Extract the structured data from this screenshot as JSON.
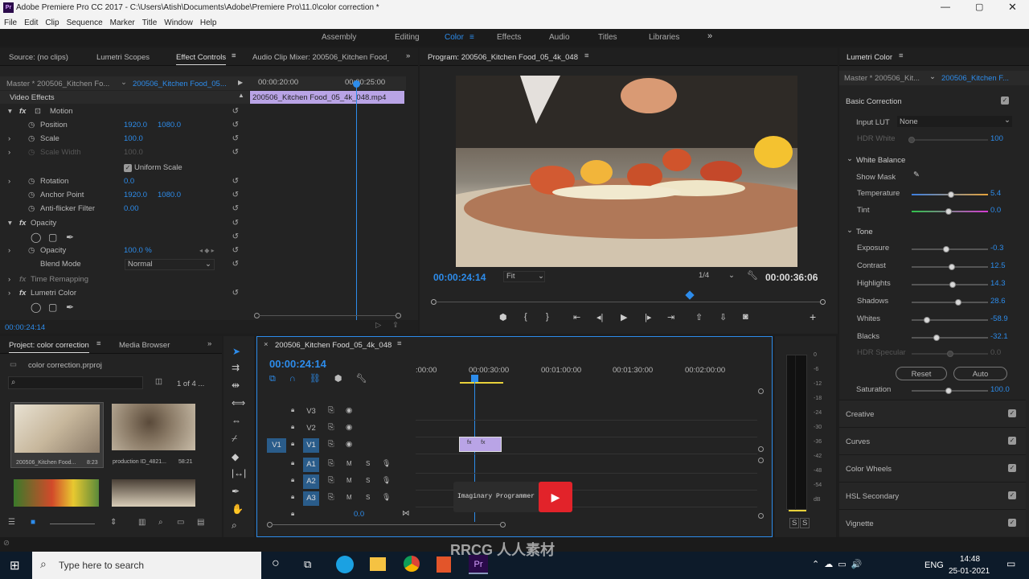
{
  "window": {
    "title": "Adobe Premiere Pro CC 2017 - C:\\Users\\Atish\\Documents\\Adobe\\Premiere Pro\\11.0\\color correction *",
    "app_icon": "Pr"
  },
  "menu": [
    "File",
    "Edit",
    "Clip",
    "Sequence",
    "Marker",
    "Title",
    "Window",
    "Help"
  ],
  "workspaces": [
    "Assembly",
    "Editing",
    "Color",
    "Effects",
    "Audio",
    "Titles",
    "Libraries"
  ],
  "active_workspace": "Color",
  "source_tabs": [
    "Source: (no clips)",
    "Lumetri Scopes",
    "Effect Controls",
    "Audio Clip Mixer: 200506_Kitchen Food_("
  ],
  "effect_controls": {
    "master": "Master * 200506_Kitchen Fo...",
    "clip": "200506_Kitchen Food_05...",
    "ruler": [
      "00:00:20:00",
      "00:00:25:00"
    ],
    "clip_bar": "200506_Kitchen Food_05_4k_048.mp4",
    "video_effects": "Video Effects",
    "motion": "Motion",
    "position": "Position",
    "pos_x": "1920.0",
    "pos_y": "1080.0",
    "scale": "Scale",
    "scale_val": "100.0",
    "scale_width": "Scale Width",
    "scale_width_val": "100.0",
    "uniform_scale": "Uniform Scale",
    "rotation": "Rotation",
    "rotation_val": "0.0",
    "anchor": "Anchor Point",
    "anchor_x": "1920.0",
    "anchor_y": "1080.0",
    "antiflicker": "Anti-flicker Filter",
    "antiflicker_val": "0.00",
    "opacity": "Opacity",
    "opacity_val": "100.0 %",
    "blend": "Blend Mode",
    "blend_val": "Normal",
    "time_remap": "Time Remapping",
    "lumetri": "Lumetri Color",
    "timecode": "00:00:24:14"
  },
  "program": {
    "title": "Program: 200506_Kitchen Food_05_4k_048",
    "timecode": "00:00:24:14",
    "fit": "Fit",
    "res": "1/4",
    "duration": "00:00:36:06",
    "playhead_fraction": 0.66
  },
  "project": {
    "tabs": [
      "Project: color correction",
      "Media Browser"
    ],
    "file": "color correction.prproj",
    "count": "1 of 4 ...",
    "items": [
      {
        "name": "200506_Kitchen Food...",
        "dur": "8:23"
      },
      {
        "name": "production ID_4821...",
        "dur": "58:21"
      }
    ]
  },
  "timeline": {
    "title": "200506_Kitchen Food_05_4k_048",
    "timecode": "00:00:24:14",
    "ruler": [
      ":00:00",
      "00:00:30:00",
      "00:01:00:00",
      "00:01:30:00",
      "00:02:00:00"
    ],
    "tracks": [
      "V3",
      "V2",
      "V1",
      "A1",
      "A2",
      "A3"
    ],
    "source_patch_v": "V1",
    "source_patch_a": "A1",
    "master_val": "0.0",
    "overlay_label": "Imaginary Programmer"
  },
  "meter": {
    "ticks": [
      "0",
      "-6",
      "-12",
      "-18",
      "-24",
      "-30",
      "-36",
      "-42",
      "-48",
      "-54",
      "dB"
    ],
    "solo": [
      "S",
      "S"
    ]
  },
  "lumetri": {
    "title": "Lumetri Color",
    "master": "Master * 200506_Kit...",
    "clip": "200506_Kitchen F...",
    "basic": "Basic Correction",
    "input_lut": "Input LUT",
    "lut_val": "None",
    "hdr_white": "HDR White",
    "hdr_white_val": "100",
    "wb": "White Balance",
    "show_mask": "Show Mask",
    "sliders": [
      {
        "label": "Temperature",
        "value": "5.4",
        "pos": 0.52
      },
      {
        "label": "Tint",
        "value": "0.0",
        "pos": 0.48
      },
      {
        "label": "Exposure",
        "value": "-0.3",
        "pos": 0.45
      },
      {
        "label": "Contrast",
        "value": "12.5",
        "pos": 0.53
      },
      {
        "label": "Highlights",
        "value": "14.3",
        "pos": 0.54
      },
      {
        "label": "Shadows",
        "value": "28.6",
        "pos": 0.61
      },
      {
        "label": "Whites",
        "value": "-58.9",
        "pos": 0.2
      },
      {
        "label": "Blacks",
        "value": "-32.1",
        "pos": 0.33
      },
      {
        "label": "HDR Specular",
        "value": "0.0",
        "pos": 0.5
      }
    ],
    "tone": "Tone",
    "reset": "Reset",
    "auto": "Auto",
    "saturation": "Saturation",
    "saturation_val": "100.0",
    "saturation_pos": 0.48,
    "sections": [
      "Creative",
      "Curves",
      "Color Wheels",
      "HSL Secondary",
      "Vignette"
    ]
  },
  "taskbar": {
    "search": "Type here to search",
    "lang": "ENG",
    "time": "14:48",
    "date": "25-01-2021"
  },
  "watermark": "RRCG 人人素材"
}
